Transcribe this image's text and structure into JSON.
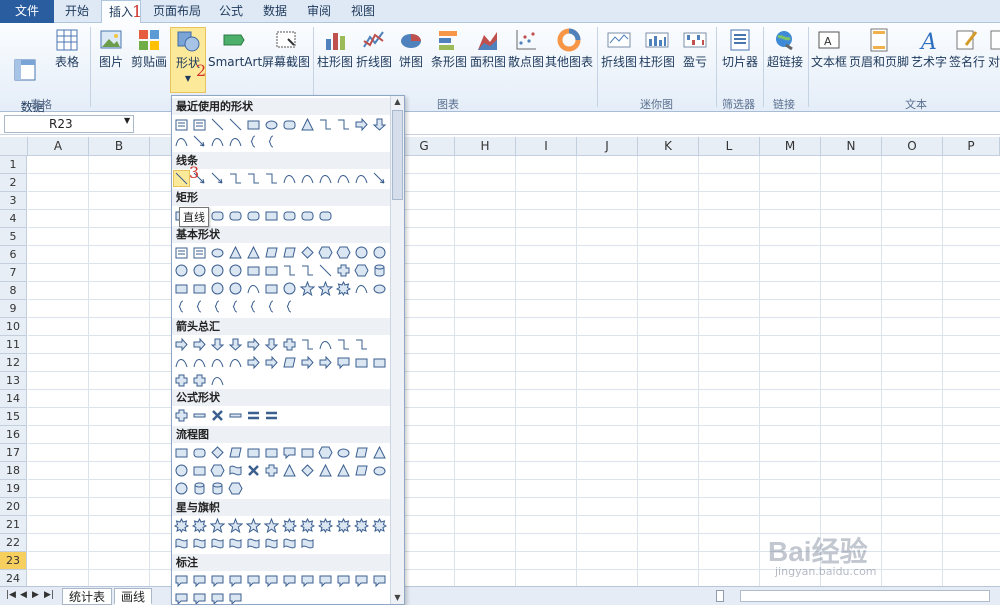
{
  "tabs": [
    "文件",
    "开始",
    "插入",
    "页面布局",
    "公式",
    "数据",
    "审阅",
    "视图"
  ],
  "ribbon": {
    "pivot": "数据\n透视表",
    "table": "表格",
    "picture": "图片",
    "clipart": "剪贴画",
    "shapes": "形状",
    "smartart": "SmartArt",
    "screenshot": "屏幕截图",
    "column": "柱形图",
    "line": "折线图",
    "pie": "饼图",
    "bar": "条形图",
    "area": "面积图",
    "scatter": "散点图",
    "other": "其他图表",
    "spark_line": "折线图",
    "spark_col": "柱形图",
    "winloss": "盈亏",
    "slicer": "切片器",
    "hyperlink": "超链接",
    "textbox": "文本框",
    "header": "页眉和页脚",
    "wordart": "艺术字",
    "signature": "签名行",
    "object": "对",
    "groups": {
      "tables": "表格",
      "charts": "图表",
      "sparklines": "迷你图",
      "filter": "筛选器",
      "links": "链接",
      "text": "文本"
    }
  },
  "namebox": "R23",
  "columns": [
    "A",
    "B",
    "C",
    "D",
    "E",
    "F",
    "G",
    "H",
    "I",
    "J",
    "K",
    "L",
    "M",
    "N",
    "O",
    "P"
  ],
  "rows": [
    "1",
    "2",
    "3",
    "4",
    "5",
    "6",
    "7",
    "8",
    "9",
    "10",
    "11",
    "12",
    "13",
    "14",
    "15",
    "16",
    "17",
    "18",
    "19",
    "20",
    "21",
    "22",
    "23",
    "24"
  ],
  "shapes_panel": {
    "recent": "最近使用的形状",
    "lines": "线条",
    "rect": "矩形",
    "basic": "基本形状",
    "arrows": "箭头总汇",
    "equation": "公式形状",
    "flow": "流程图",
    "stars": "星与旗帜",
    "callout": "标注",
    "tooltip": "直线"
  },
  "sheet_tabs": [
    "统计表",
    "画线"
  ],
  "annotations": [
    "1",
    "2",
    "3"
  ],
  "watermark": {
    "brand": "Bai经验",
    "url": "jingyan.baidu.com"
  }
}
